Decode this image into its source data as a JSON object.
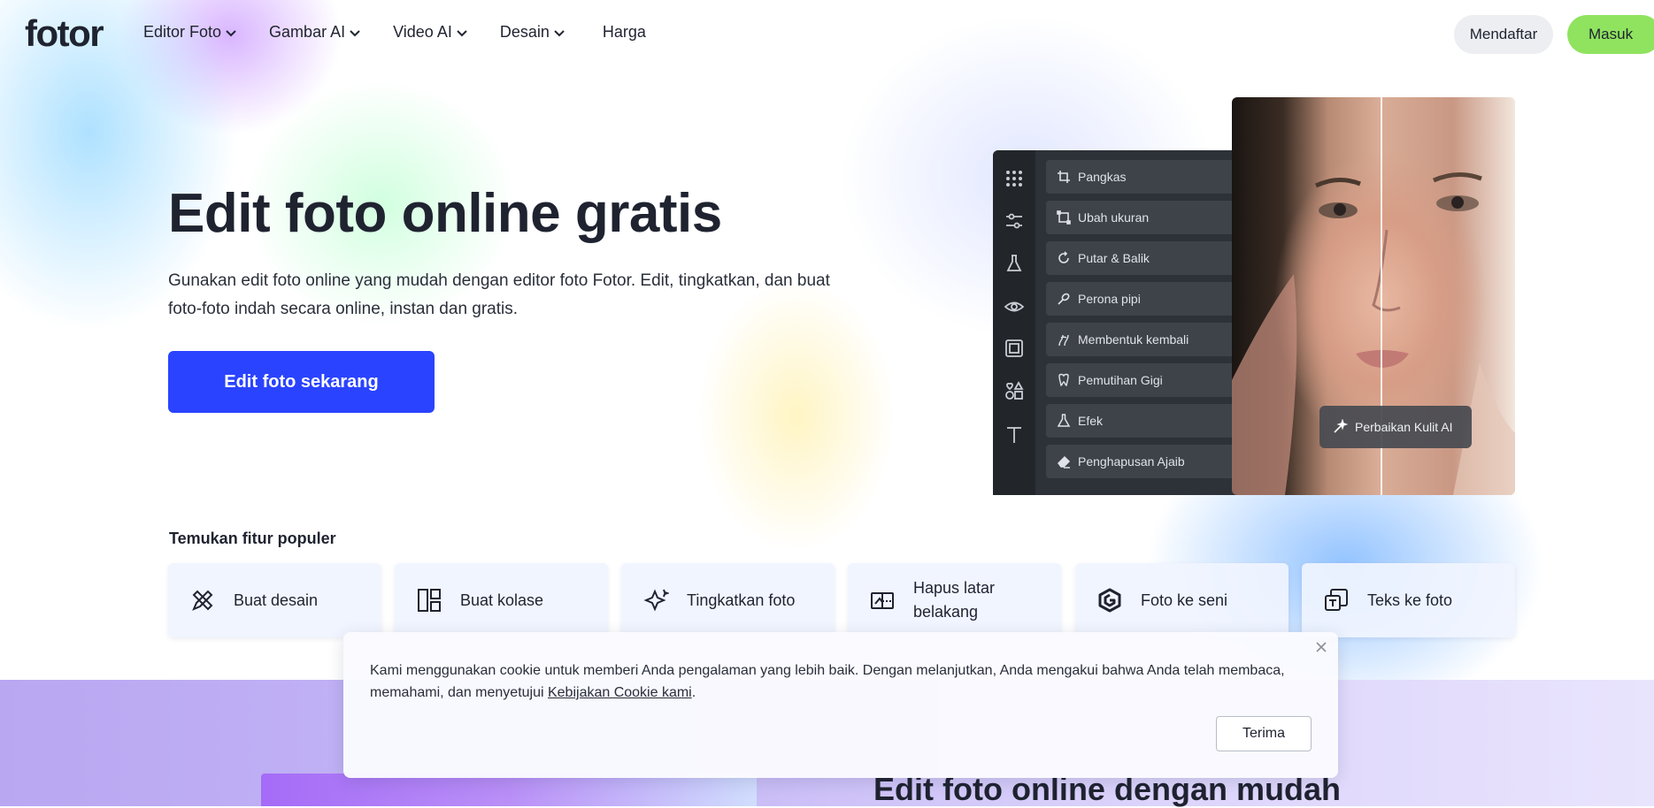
{
  "header": {
    "logo": "fotor",
    "nav": [
      {
        "label": "Editor Foto",
        "dropdown": true
      },
      {
        "label": "Gambar AI",
        "dropdown": true
      },
      {
        "label": "Video AI",
        "dropdown": true
      },
      {
        "label": "Desain",
        "dropdown": true
      },
      {
        "label": "Harga",
        "dropdown": false
      }
    ],
    "signup_label": "Mendaftar",
    "login_label": "Masuk"
  },
  "hero": {
    "title": "Edit foto online gratis",
    "subtitle": "Gunakan edit foto online yang mudah dengan editor foto Fotor. Edit, tingkatkan, dan buat foto-foto indah secara online, instan dan gratis.",
    "cta_label": "Edit foto sekarang"
  },
  "editor_mockup": {
    "tools": [
      {
        "label": "Pangkas",
        "icon": "crop-icon"
      },
      {
        "label": "Ubah ukuran",
        "icon": "resize-icon"
      },
      {
        "label": "Putar & Balik",
        "icon": "rotate-icon"
      },
      {
        "label": "Perona pipi",
        "icon": "blush-icon"
      },
      {
        "label": "Membentuk kembali",
        "icon": "reshape-icon"
      },
      {
        "label": "Pemutihan Gigi",
        "icon": "tooth-icon"
      },
      {
        "label": "Efek",
        "icon": "flask-icon"
      },
      {
        "label": "Penghapusan Ajaib",
        "icon": "eraser-icon"
      }
    ],
    "ai_badge": "Perbaikan Kulit AI"
  },
  "features": {
    "title": "Temukan fitur populer",
    "items": [
      {
        "label": "Buat desain",
        "icon": "design-tools-icon"
      },
      {
        "label": "Buat kolase",
        "icon": "collage-icon"
      },
      {
        "label": "Tingkatkan foto",
        "icon": "enhance-sparkle-icon"
      },
      {
        "label": "Hapus latar belakang",
        "icon": "remove-background-icon"
      },
      {
        "label": "Foto ke seni",
        "icon": "art-logo-icon"
      },
      {
        "label": "Teks ke foto",
        "icon": "text-to-image-icon"
      }
    ]
  },
  "cookie": {
    "text": "Kami menggunakan cookie untuk memberi Anda pengalaman yang lebih baik. Dengan melanjutkan, Anda mengakui bahwa Anda telah membaca, memahami, dan menyetujui ",
    "link_label": "Kebijakan Cookie kami",
    "suffix": ".",
    "accept_label": "Terima"
  },
  "section2": {
    "title": "Edit foto online dengan mudah"
  },
  "colors": {
    "cta": "#2a43ff",
    "login": "#8fe35f",
    "signup": "#eceef1",
    "text": "#1f2330"
  }
}
